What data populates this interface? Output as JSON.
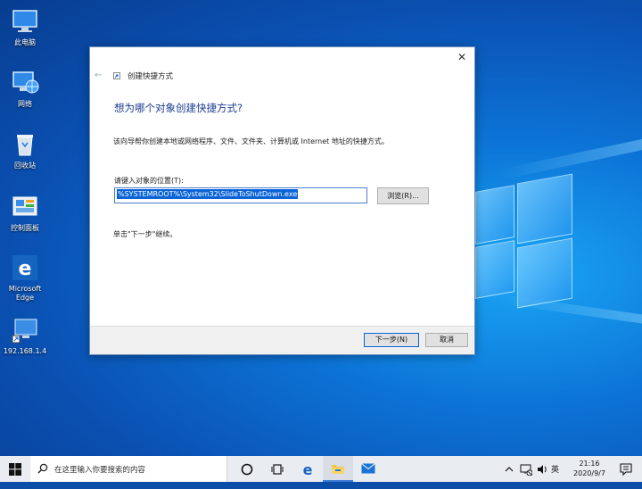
{
  "desktop": {
    "icons": [
      {
        "label": "此电脑"
      },
      {
        "label": "网络"
      },
      {
        "label": "回收站"
      },
      {
        "label": "控制面板"
      },
      {
        "label": "Microsoft Edge"
      },
      {
        "label": "192.168.1.4"
      }
    ]
  },
  "dialog": {
    "title": "创建快捷方式",
    "heading": "想为哪个对象创建快捷方式?",
    "description": "该向导帮你创建本地或网络程序、文件、文件夹、计算机或 Internet 地址的快捷方式。",
    "location_label": "请键入对象的位置(T):",
    "location_value": "%SYSTEMROOT%\\System32\\SlideToShutDown.exe",
    "browse_label": "浏览(R)...",
    "hint": "单击\"下一步\"继续。",
    "next_label": "下一步(N)",
    "cancel_label": "取消",
    "close_glyph": "✕",
    "back_glyph": "←"
  },
  "taskbar": {
    "search_placeholder": "在这里输入你要搜索的内容",
    "ime": "英",
    "time": "21:16",
    "date": "2020/9/7"
  },
  "colors": {
    "accent": "#0a64d8",
    "annotation_arrow": "#e8322a",
    "heading": "#1a3c8f"
  }
}
